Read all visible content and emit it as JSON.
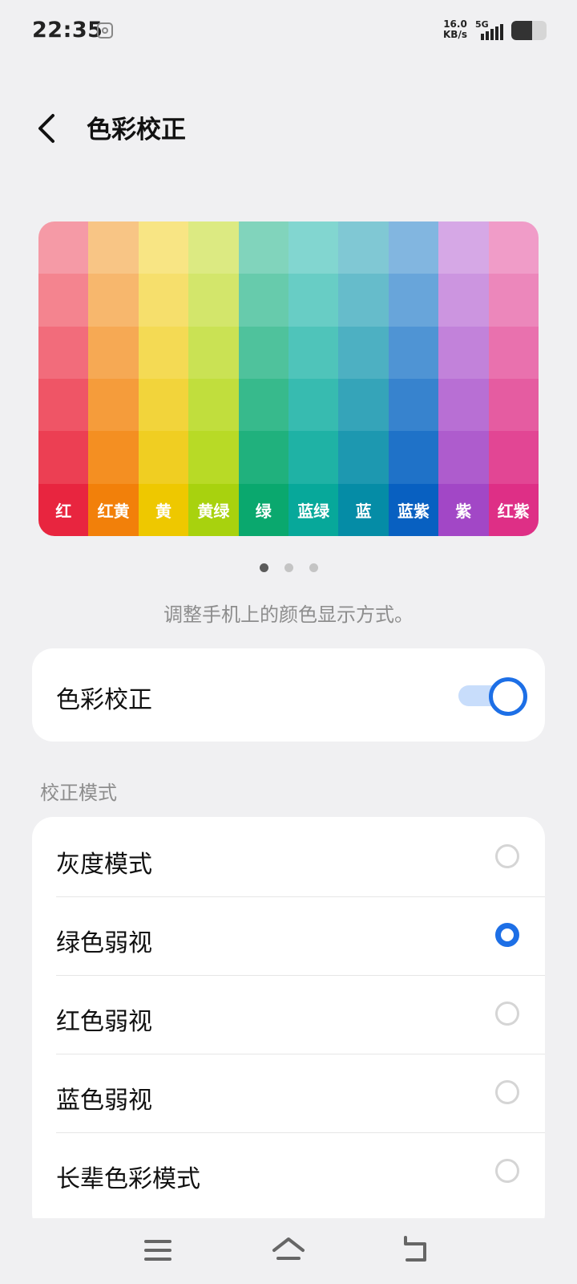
{
  "status_bar": {
    "time": "22:35",
    "net_speed_value": "16.0",
    "net_speed_unit": "KB/s",
    "network_type": "5G",
    "battery_level": 0.6,
    "icons": [
      "notification-icon",
      "signal-icon",
      "battery-icon"
    ]
  },
  "header": {
    "title": "色彩校正",
    "back_icon": "chevron-left-icon"
  },
  "palette": {
    "columns": [
      {
        "label": "红",
        "colors": [
          "#f59aa6",
          "#f4848f",
          "#f26c7b",
          "#ef5566",
          "#ec3f53",
          "#e8253f"
        ]
      },
      {
        "label": "红黄",
        "colors": [
          "#f8c585",
          "#f7b76d",
          "#f6a954",
          "#f59c3b",
          "#f48f22",
          "#f2800a"
        ]
      },
      {
        "label": "黄",
        "colors": [
          "#f8e584",
          "#f6df6c",
          "#f4da54",
          "#f2d43b",
          "#f0ce22",
          "#eec800"
        ]
      },
      {
        "label": "黄绿",
        "colors": [
          "#dcea82",
          "#d3e66b",
          "#cae254",
          "#c1de3d",
          "#b8da26",
          "#a8d20e"
        ]
      },
      {
        "label": "绿",
        "colors": [
          "#81d4bc",
          "#67cbac",
          "#4fc29c",
          "#37ba8c",
          "#20b17d",
          "#0aa86e"
        ]
      },
      {
        "label": "蓝绿",
        "colors": [
          "#82d6d0",
          "#68cdc5",
          "#4fc4ba",
          "#37bbb0",
          "#1fb2a5",
          "#07a89a"
        ]
      },
      {
        "label": "蓝",
        "colors": [
          "#80c8d4",
          "#66bccb",
          "#4db0c2",
          "#35a4b9",
          "#1d98b0",
          "#058ca6"
        ]
      },
      {
        "label": "蓝紫",
        "colors": [
          "#82b6e0",
          "#68a5da",
          "#4f94d4",
          "#3783ce",
          "#1f72c8",
          "#0860c1"
        ]
      },
      {
        "label": "紫",
        "colors": [
          "#d6a8e6",
          "#cc95e0",
          "#c282da",
          "#b86fd4",
          "#ae5ccd",
          "#a247c6"
        ]
      },
      {
        "label": "红紫",
        "colors": [
          "#f09cc8",
          "#ec87bb",
          "#e971ae",
          "#e55ca1",
          "#e24694",
          "#de2f86"
        ]
      }
    ]
  },
  "pager": {
    "count": 3,
    "active": 0
  },
  "description": "调整手机上的颜色显示方式。",
  "toggle": {
    "label": "色彩校正",
    "enabled": true,
    "accent": "#1d6fe6"
  },
  "section_label": "校正模式",
  "modes": [
    {
      "label": "灰度模式",
      "selected": false
    },
    {
      "label": "绿色弱视",
      "selected": true
    },
    {
      "label": "红色弱视",
      "selected": false
    },
    {
      "label": "蓝色弱视",
      "selected": false
    },
    {
      "label": "长辈色彩模式",
      "selected": false
    }
  ],
  "nav_bar": {
    "icons": [
      "menu-icon",
      "home-icon",
      "back-icon"
    ]
  }
}
